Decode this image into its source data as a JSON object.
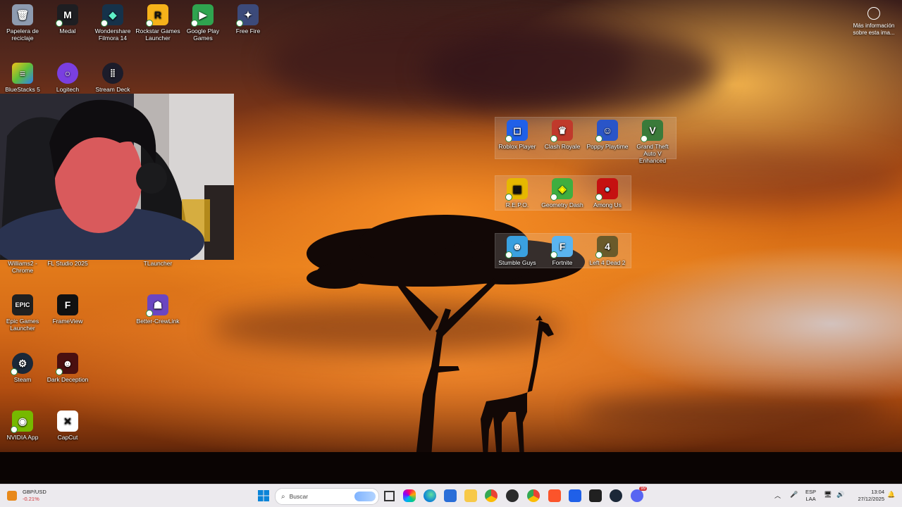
{
  "desktop": {
    "icons": [
      {
        "label": "Papelera de reciclaje",
        "icon": "recycle-bin-icon",
        "color": "#9aa4b4"
      },
      {
        "label": "Medal",
        "icon": "medal-icon",
        "color": "#1e1e22"
      },
      {
        "label": "Wondershare Filmora 14",
        "icon": "filmora-icon",
        "color": "#16324a"
      },
      {
        "label": "Rockstar Games Launcher",
        "icon": "rockstar-icon",
        "color": "#f6b21a"
      },
      {
        "label": "Google Play Games",
        "icon": "google-play-games-icon",
        "color": "#2fa44f"
      },
      {
        "label": "Free Fire",
        "icon": "free-fire-icon",
        "color": "#3c4a7a"
      },
      {
        "label": "BlueStacks 5",
        "icon": "bluestacks-icon",
        "color": "#5fbf3a"
      },
      {
        "label": "Logitech Capture",
        "icon": "logitech-capture-icon",
        "color": "#7a3fe0"
      },
      {
        "label": "Stream Deck",
        "icon": "stream-deck-icon",
        "color": "#1c1c2a"
      },
      {
        "label": "Williams2 - Chrome",
        "icon": "chrome-icon",
        "color": "#4285f4"
      },
      {
        "label": "FL Studio 2025",
        "icon": "fl-studio-icon",
        "color": "#f28b1c"
      },
      {
        "label": "TLauncher",
        "icon": "tlauncher-icon",
        "color": "#2f6b2f"
      },
      {
        "label": "Epic Games Launcher",
        "icon": "epic-games-icon",
        "color": "#202020"
      },
      {
        "label": "FrameView",
        "icon": "frameview-icon",
        "color": "#111111"
      },
      {
        "label": "Better-CrewLink",
        "icon": "better-crewlink-icon",
        "color": "#6b46c1"
      },
      {
        "label": "Steam",
        "icon": "steam-icon",
        "color": "#1b2838"
      },
      {
        "label": "Dark Deception",
        "icon": "dark-deception-icon",
        "color": "#4a1010"
      },
      {
        "label": "NVIDIA App",
        "icon": "nvidia-icon",
        "color": "#76b900"
      },
      {
        "label": "CapCut",
        "icon": "capcut-icon",
        "color": "#ffffff"
      }
    ],
    "group_icons": [
      {
        "label": "Roblox Player",
        "icon": "roblox-icon",
        "color": "#2060e8"
      },
      {
        "label": "Clash Royale",
        "icon": "clash-royale-icon",
        "color": "#c0392b"
      },
      {
        "label": "Poppy Playtime",
        "icon": "poppy-playtime-icon",
        "color": "#2a55c8"
      },
      {
        "label": "Grand Theft Auto V Enhanced",
        "icon": "gta-v-icon",
        "color": "#3a7a3a"
      },
      {
        "label": "R.E.P.O.",
        "icon": "repo-icon",
        "color": "#e6b800"
      },
      {
        "label": "Geometry Dash",
        "icon": "geometry-dash-icon",
        "color": "#3fae3f"
      },
      {
        "label": "Among Us",
        "icon": "among-us-icon",
        "color": "#c51111"
      },
      {
        "label": "Stumble Guys",
        "icon": "stumble-guys-icon",
        "color": "#3aa0e0"
      },
      {
        "label": "Fortnite",
        "icon": "fortnite-icon",
        "color": "#5ab4f0"
      },
      {
        "label": "Left 4 Dead 2",
        "icon": "left4dead2-icon",
        "color": "#6a5a2a"
      }
    ],
    "info_label": "Más información sobre esta ima..."
  },
  "taskbar": {
    "widget": {
      "symbol": "GBP/USD",
      "change": "-0.21%"
    },
    "search_placeholder": "Buscar",
    "language": "ESP",
    "layout": "LAA",
    "time": "13:04",
    "date": "27/12/2025",
    "discord_badge": "99",
    "colors": {
      "widget_down": "#d13438",
      "accent": "#0078d4"
    }
  }
}
